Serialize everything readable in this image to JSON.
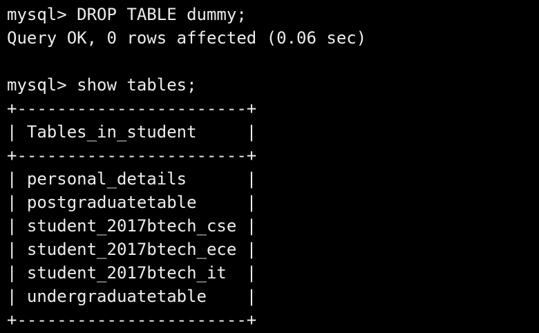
{
  "terminal": {
    "lines": [
      "mysql> DROP TABLE dummy;",
      "Query OK, 0 rows affected (0.06 sec)",
      "",
      "mysql> show tables;",
      "+-----------------------+",
      "| Tables_in_student     |",
      "+-----------------------+",
      "| personal_details      |",
      "| postgraduatetable     |",
      "| student_2017btech_cse |",
      "| student_2017btech_ece |",
      "| student_2017btech_it  |",
      "| undergraduatetable    |",
      "+-----------------------+"
    ]
  }
}
